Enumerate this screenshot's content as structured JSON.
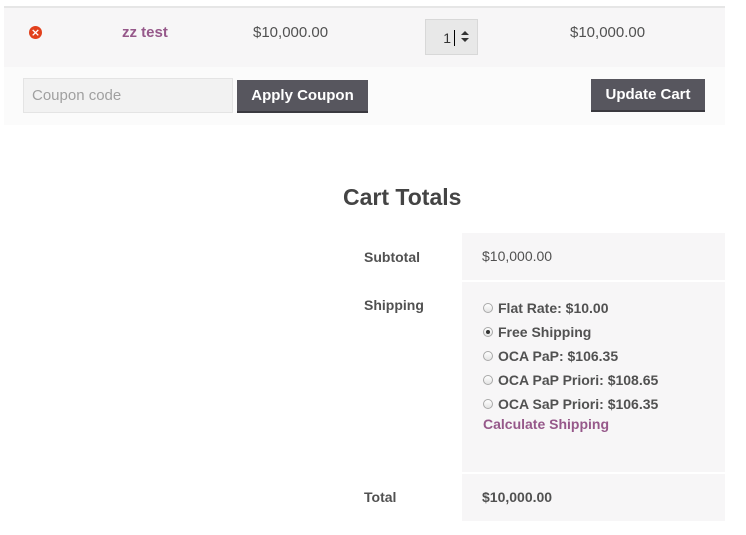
{
  "cart_item": {
    "remove_icon": "close-circle-icon",
    "remove_symbol": "×",
    "product_name": "zz test",
    "price": "$10,000.00",
    "quantity": "1",
    "line_total": "$10,000.00"
  },
  "actions": {
    "coupon_placeholder": "Coupon code",
    "coupon_value": "",
    "apply_coupon_label": "Apply Coupon",
    "update_cart_label": "Update Cart"
  },
  "cart_totals": {
    "title": "Cart Totals",
    "subtotal_label": "Subtotal",
    "subtotal_value": "$10,000.00",
    "shipping_label": "Shipping",
    "shipping_options": [
      {
        "label": "Flat Rate: $10.00",
        "selected": false
      },
      {
        "label": "Free Shipping",
        "selected": true
      },
      {
        "label": "OCA PaP: $106.35",
        "selected": false
      },
      {
        "label": "OCA PaP Priori: $108.65",
        "selected": false
      },
      {
        "label": "OCA SaP Priori: $106.35",
        "selected": false
      }
    ],
    "calculate_shipping_label": "Calculate Shipping",
    "total_label": "Total",
    "total_value": "$10,000.00"
  },
  "colors": {
    "accent_link": "#96588a",
    "button_bg": "#57565e",
    "remove_red": "#e2401c",
    "row_bg": "#f7f6f7"
  }
}
